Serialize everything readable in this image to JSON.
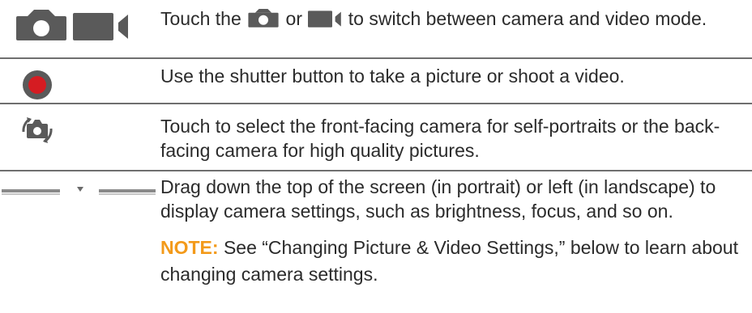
{
  "rows": [
    {
      "icon": "camera-video-mode-icons",
      "text_part1": "Touch the",
      "text_or": "or",
      "text_part2": "to switch between camera and video mode."
    },
    {
      "icon": "shutter-button-icon",
      "text": "Use the shutter button to take a picture or shoot a video."
    },
    {
      "icon": "switch-camera-icon",
      "text": "Touch to select the front-facing camera for self-portraits or the back-facing camera for high quality pictures."
    },
    {
      "icon": "settings-drag-handle-icon",
      "text": "Drag down the top of the screen (in portrait) or left (in landscape) to display camera settings, such as brightness, focus, and so on.",
      "note_label": "NOTE:",
      "note_text": "See “Changing Picture & Video Settings,” below to learn about changing camera settings."
    }
  ],
  "colors": {
    "text": "#2b2b2b",
    "icon_gray": "#5a5a5a",
    "shutter_red": "#d51c22",
    "note_orange": "#f39a1a",
    "separator": "#6f6f6f"
  }
}
